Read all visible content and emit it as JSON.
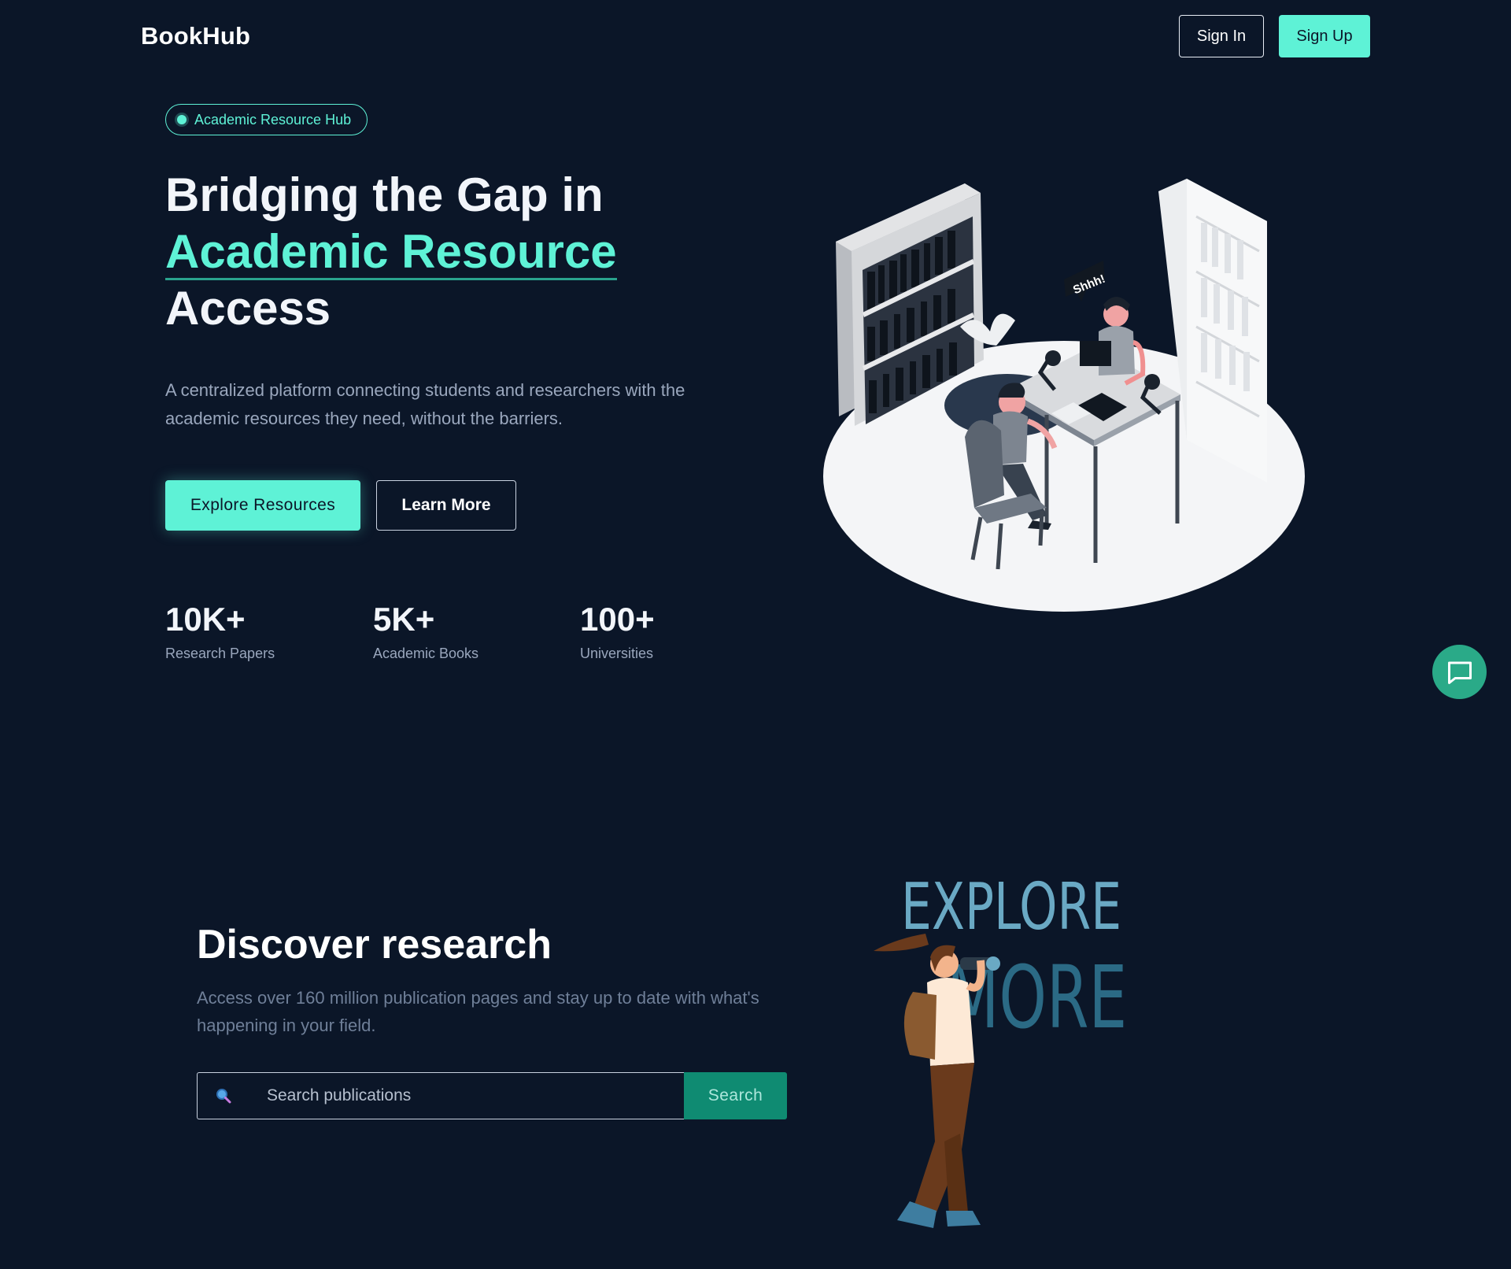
{
  "nav": {
    "logo": "BookHub",
    "signin_label": "Sign In",
    "signup_label": "Sign Up"
  },
  "hero": {
    "badge": "Academic Resource Hub",
    "title_line1": "Bridging the Gap in",
    "title_accent": "Academic Resource",
    "title_line3": "Access",
    "subtitle": "A centralized platform connecting students and researchers with the academic resources they need, without the barriers.",
    "primary_button": "Explore Resources",
    "secondary_button": "Learn More",
    "stats": [
      {
        "value": "10K+",
        "label": "Research Papers"
      },
      {
        "value": "5K+",
        "label": "Academic Books"
      },
      {
        "value": "100+",
        "label": "Universities"
      }
    ],
    "illustration_bubble": "Shhh!"
  },
  "discover": {
    "title": "Discover research",
    "subtitle": "Access over 160 million publication pages and stay up to date with what's happening in your field.",
    "search_placeholder": "Search publications",
    "search_button": "Search",
    "illustration_text": {
      "word1": "EXPLORE",
      "word2": "MORE"
    }
  },
  "chat": {
    "icon": "chat-bubble-icon"
  },
  "colors": {
    "background": "#0b1628",
    "accent": "#5ef2d6",
    "search_button": "#0f8b72",
    "chat_fab": "#2aaa88"
  }
}
